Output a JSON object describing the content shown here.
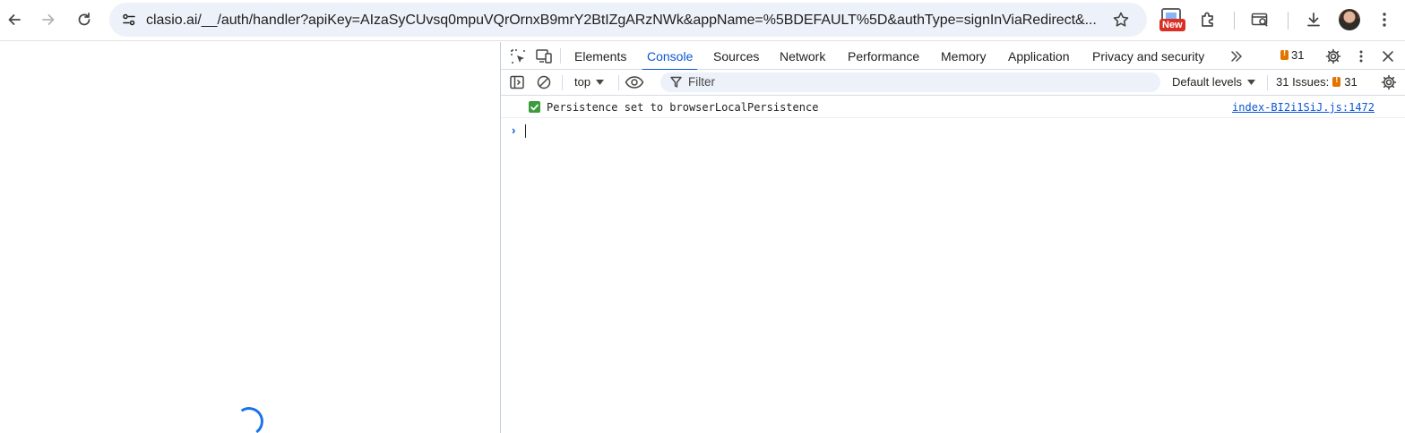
{
  "browser": {
    "url": "clasio.ai/__/auth/handler?apiKey=AIzaSyCUvsq0mpuVQrOrnxB9mrY2BtIZgARzNWk&appName=%5BDEFAULT%5D&authType=signInViaRedirect&...",
    "new_badge": "New"
  },
  "devtools": {
    "tabs": [
      "Elements",
      "Console",
      "Sources",
      "Network",
      "Performance",
      "Memory",
      "Application",
      "Privacy and security"
    ],
    "active_tab": "Console",
    "issue_count": "31",
    "toolbar": {
      "context": "top",
      "filter_placeholder": "Filter",
      "levels": "Default levels",
      "issues_label": "31 Issues:",
      "issues_count": "31"
    },
    "console": {
      "messages": [
        {
          "icon": "check-icon",
          "text": "Persistence set to browserLocalPersistence",
          "source": "index-BI2i1SiJ.js:1472"
        }
      ]
    }
  },
  "colors": {
    "accent": "#0b57d0",
    "omnibox_bg": "#edf1f9",
    "issue_orange": "#e37400",
    "success_green": "#3c9c3c"
  }
}
